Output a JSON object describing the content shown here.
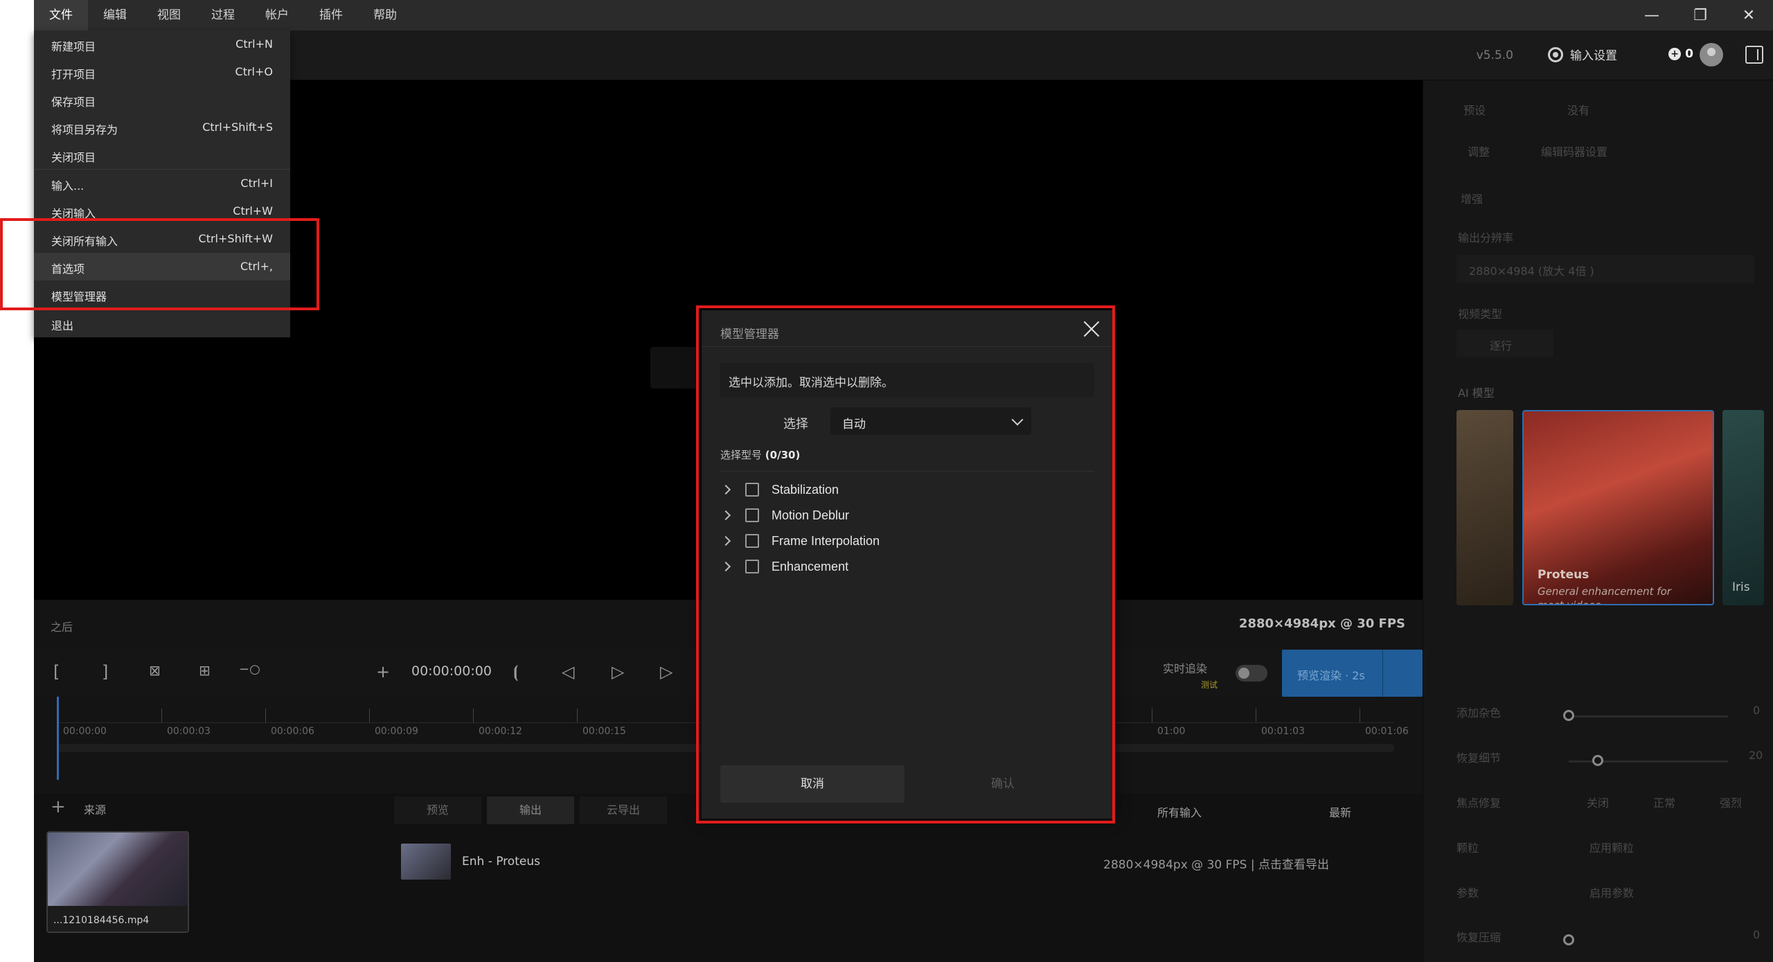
{
  "menubar": {
    "items": [
      "文件",
      "编辑",
      "视图",
      "过程",
      "帐户",
      "插件",
      "帮助"
    ]
  },
  "toolbar": {
    "version": "v5.5.0",
    "input_settings": "输入设置",
    "credits": "0"
  },
  "file_menu": {
    "items": [
      {
        "label": "新建项目",
        "shortcut": "Ctrl+N"
      },
      {
        "label": "打开项目",
        "shortcut": "Ctrl+O"
      },
      {
        "label": "保存项目",
        "shortcut": ""
      },
      {
        "label": "将项目另存为",
        "shortcut": "Ctrl+Shift+S"
      },
      {
        "label": "关闭项目",
        "shortcut": ""
      },
      {
        "label": "输入...",
        "shortcut": "Ctrl+I"
      },
      {
        "label": "关闭输入",
        "shortcut": "Ctrl+W"
      },
      {
        "label": "关闭所有输入",
        "shortcut": "Ctrl+Shift+W"
      },
      {
        "label": "首选项",
        "shortcut": "Ctrl+,"
      },
      {
        "label": "模型管理器",
        "shortcut": ""
      },
      {
        "label": "退出",
        "shortcut": ""
      }
    ]
  },
  "preview": {
    "after_label": "之后",
    "resolution": "2880×4984px @ 30 FPS"
  },
  "transport": {
    "timecode": "00:00:00:00",
    "realtime_label": "实时追染",
    "realtime_sub": "测试",
    "preview_button": "预览渲染 · 2s"
  },
  "timeline": {
    "ticks": [
      "00:00:00",
      "00:00:03",
      "00:00:06",
      "00:00:09",
      "00:00:12",
      "00:00:15",
      "01:00",
      "00:01:03",
      "00:01:06"
    ]
  },
  "bottom": {
    "source_label": "来源",
    "thumb_name": "...1210184456.mp4",
    "tabs": [
      "预览",
      "输出",
      "云导出"
    ],
    "filter_all": "所有输入",
    "filter_sort": "最新",
    "export_name": "Enh - Proteus",
    "export_res": "2880×4984px @ 30 FPS",
    "export_hint": "点击查看导出"
  },
  "right_panel": {
    "preset_label": "预设",
    "preset_value": "没有",
    "adjust_tab": "调整",
    "editing_tab": "编辑码器设置",
    "enhance_section": "增强",
    "output_res_label": "输出分辨率",
    "output_res_value": "2880×4984 (放大 4倍 )",
    "video_type_label": "视频类型",
    "video_type_value": "逐行",
    "ai_model_label": "AI 模型",
    "card_main_title": "Proteus",
    "card_main_desc": "General enhancement for most videos",
    "card_right_title": "Iris",
    "sliders": [
      {
        "label": "添加杂色",
        "value": "0"
      },
      {
        "label": "恢复细节",
        "value": "20"
      }
    ],
    "focus_label": "焦点修复",
    "focus_options": [
      "关闭",
      "正常",
      "强烈"
    ],
    "grain_label": "颗粒",
    "grain_option": "应用颗粒",
    "params_label": "参数",
    "params_option": "启用参数",
    "compress_label": "恢复压缩",
    "compress_value": "0"
  },
  "dialog": {
    "title": "模型管理器",
    "notice": "选中以添加。取消选中以删除。",
    "select_label": "选择",
    "select_value": "自动",
    "count_label": "选择型号",
    "count_value": "(0/30)",
    "models": [
      "Stabilization",
      "Motion Deblur",
      "Frame Interpolation",
      "Enhancement"
    ],
    "cancel": "取消",
    "confirm": "确认"
  },
  "colors": {
    "highlight": "#e21b1b",
    "accent": "#1f5c98",
    "background": "#121212"
  }
}
